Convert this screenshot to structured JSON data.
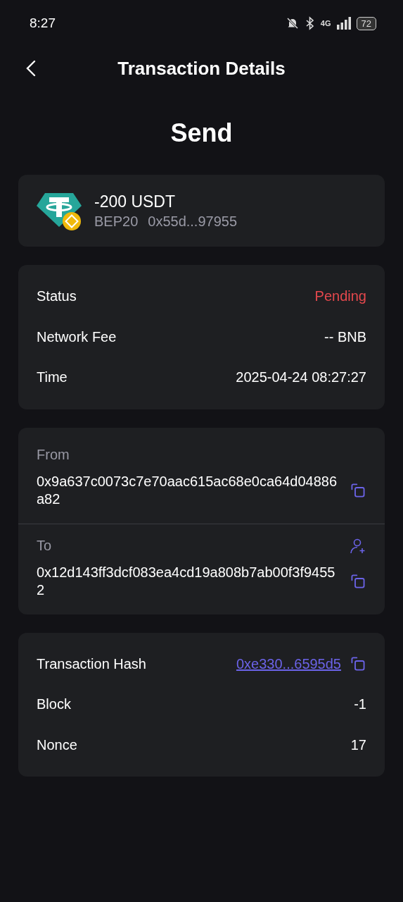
{
  "status_bar": {
    "time": "8:27",
    "network": "4G",
    "battery": "72"
  },
  "header": {
    "title": "Transaction Details"
  },
  "type_title": "Send",
  "asset": {
    "amount": "-200 USDT",
    "network": "BEP20",
    "address": "0x55d...97955"
  },
  "details": [
    {
      "label": "Status",
      "value": "Pending",
      "color": "#e5484d"
    },
    {
      "label": "Network Fee",
      "value": "-- BNB",
      "color": "#ffffff"
    },
    {
      "label": "Time",
      "value": "2025-04-24 08:27:27",
      "color": "#ffffff"
    }
  ],
  "parties": [
    {
      "label": "From",
      "address": "0x9a637c0073c7e70aac615ac68e0ca64d04886a82",
      "add_contact": false
    },
    {
      "label": "To",
      "address": "0x12d143ff3dcf083ea4cd19a808b7ab00f3f94552",
      "add_contact": true
    }
  ],
  "chain_info": [
    {
      "label": "Transaction Hash",
      "value": "0xe330...6595d5",
      "kind": "link"
    },
    {
      "label": "Block",
      "value": "-1",
      "kind": "text"
    },
    {
      "label": "Nonce",
      "value": "17",
      "kind": "text"
    }
  ]
}
